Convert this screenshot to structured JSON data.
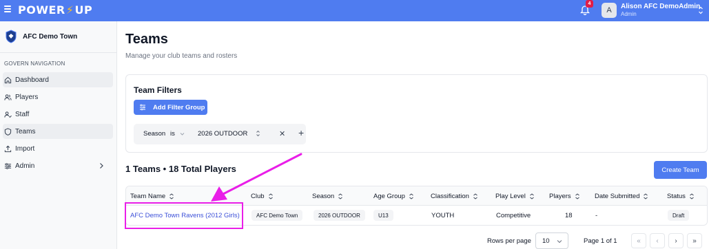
{
  "app": {
    "logo_left": "POWER",
    "logo_bolt": "⚡",
    "logo_right": "UP",
    "notification_count": "4"
  },
  "user": {
    "initial": "A",
    "name": "Alison AFC DemoAdmin",
    "role": "Admin"
  },
  "sidebar": {
    "club_name": "AFC Demo Town",
    "nav_heading": "GOVERN NAVIGATION",
    "items": [
      {
        "label": "Dashboard",
        "icon": "home-icon"
      },
      {
        "label": "Players",
        "icon": "users-icon"
      },
      {
        "label": "Staff",
        "icon": "user-check-icon"
      },
      {
        "label": "Teams",
        "icon": "shield-icon"
      },
      {
        "label": "Import",
        "icon": "upload-icon"
      },
      {
        "label": "Admin",
        "icon": "settings-sliders-icon"
      }
    ]
  },
  "page": {
    "title": "Teams",
    "subtitle": "Manage your club teams and rosters"
  },
  "filters": {
    "title": "Team Filters",
    "add_group_label": "Add Filter Group",
    "row": {
      "field": "Season",
      "operator": "is",
      "value": "2026 OUTDOOR",
      "remove": "✕",
      "add": "+"
    }
  },
  "summary": "1 Teams • 18 Total Players",
  "create_team_label": "Create Team",
  "table": {
    "columns": [
      "Team Name",
      "Club",
      "Season",
      "Age Group",
      "Classification",
      "Play Level",
      "Players",
      "Date Submitted",
      "Status"
    ],
    "rows": [
      {
        "team_name": "AFC Demo Town Ravens (2012 Girls)",
        "club": "AFC Demo Town",
        "season": "2026 OUTDOOR",
        "age_group": "U13",
        "classification": "YOUTH",
        "play_level": "Competitive",
        "players": "18",
        "date_submitted": "-",
        "status": "Draft"
      }
    ]
  },
  "pagination": {
    "rows_per_page_label": "Rows per page",
    "rows_per_page": "10",
    "page_info": "Page 1 of 1",
    "first": "«",
    "prev": "‹",
    "next": "›",
    "last": "»"
  },
  "colors": {
    "brand": "#4f7cf0",
    "annotation": "#e91ee8",
    "link": "#3b4fd8"
  }
}
